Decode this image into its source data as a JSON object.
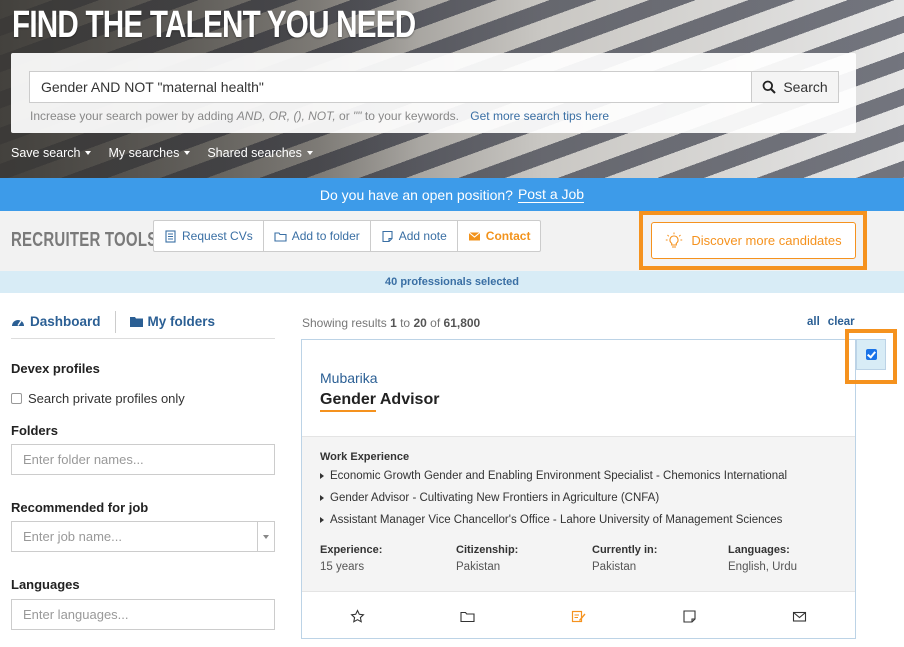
{
  "hero": {
    "title": "FIND THE TALENT YOU NEED",
    "search_value": "Gender AND NOT \"maternal health\"",
    "search_button": "Search",
    "hint_prefix": "Increase your search power by adding ",
    "hint_ops": "AND, OR, (), NOT,",
    "hint_or": " or ",
    "hint_quotes": "\"\"",
    "hint_suffix": " to your keywords.",
    "hint_link": "Get more search tips here",
    "menus": [
      "Save search",
      "My searches",
      "Shared searches"
    ]
  },
  "post_bar": {
    "text": "Do you have an open position?",
    "link": "Post a Job"
  },
  "tools": {
    "label": "RECRUITER TOOLS",
    "buttons": [
      "Request CVs",
      "Add to folder",
      "Add note",
      "Contact"
    ],
    "discover": "Discover more candidates"
  },
  "selection": {
    "text": "40 professionals selected"
  },
  "sidebar": {
    "tabs": [
      "Dashboard",
      "My folders"
    ],
    "devex_heading": "Devex profiles",
    "private_label": "Search private profiles only",
    "folders_heading": "Folders",
    "folders_placeholder": "Enter folder names...",
    "recommended_heading": "Recommended for job",
    "job_placeholder": "Enter job name...",
    "languages_heading": "Languages",
    "languages_placeholder": "Enter languages..."
  },
  "results": {
    "showing": "Showing results",
    "from": "1",
    "to_word": "to",
    "to": "20",
    "of_word": "of",
    "total": "61,800",
    "all": "all",
    "clear": "clear"
  },
  "card": {
    "name": "Mubarika",
    "title_highlight": "Gender",
    "title_rest": " Advisor",
    "work_heading": "Work Experience",
    "work": [
      "Economic Growth Gender and Enabling Environment Specialist - Chemonics International",
      "Gender Advisor - Cultivating New Frontiers in Agriculture (CNFA)",
      "Assistant Manager Vice Chancellor's Office - Lahore University of Management Sciences"
    ],
    "stats": [
      {
        "k": "Experience:",
        "v": "15 years"
      },
      {
        "k": "Citizenship:",
        "v": "Pakistan"
      },
      {
        "k": "Currently in:",
        "v": "Pakistan"
      },
      {
        "k": "Languages:",
        "v": "English, Urdu"
      }
    ],
    "selected": true
  },
  "colors": {
    "accent_orange": "#f5921e",
    "blue_bar": "#3d9be9",
    "link_blue": "#2b5f94",
    "selected_bg": "#d8ecf6"
  }
}
